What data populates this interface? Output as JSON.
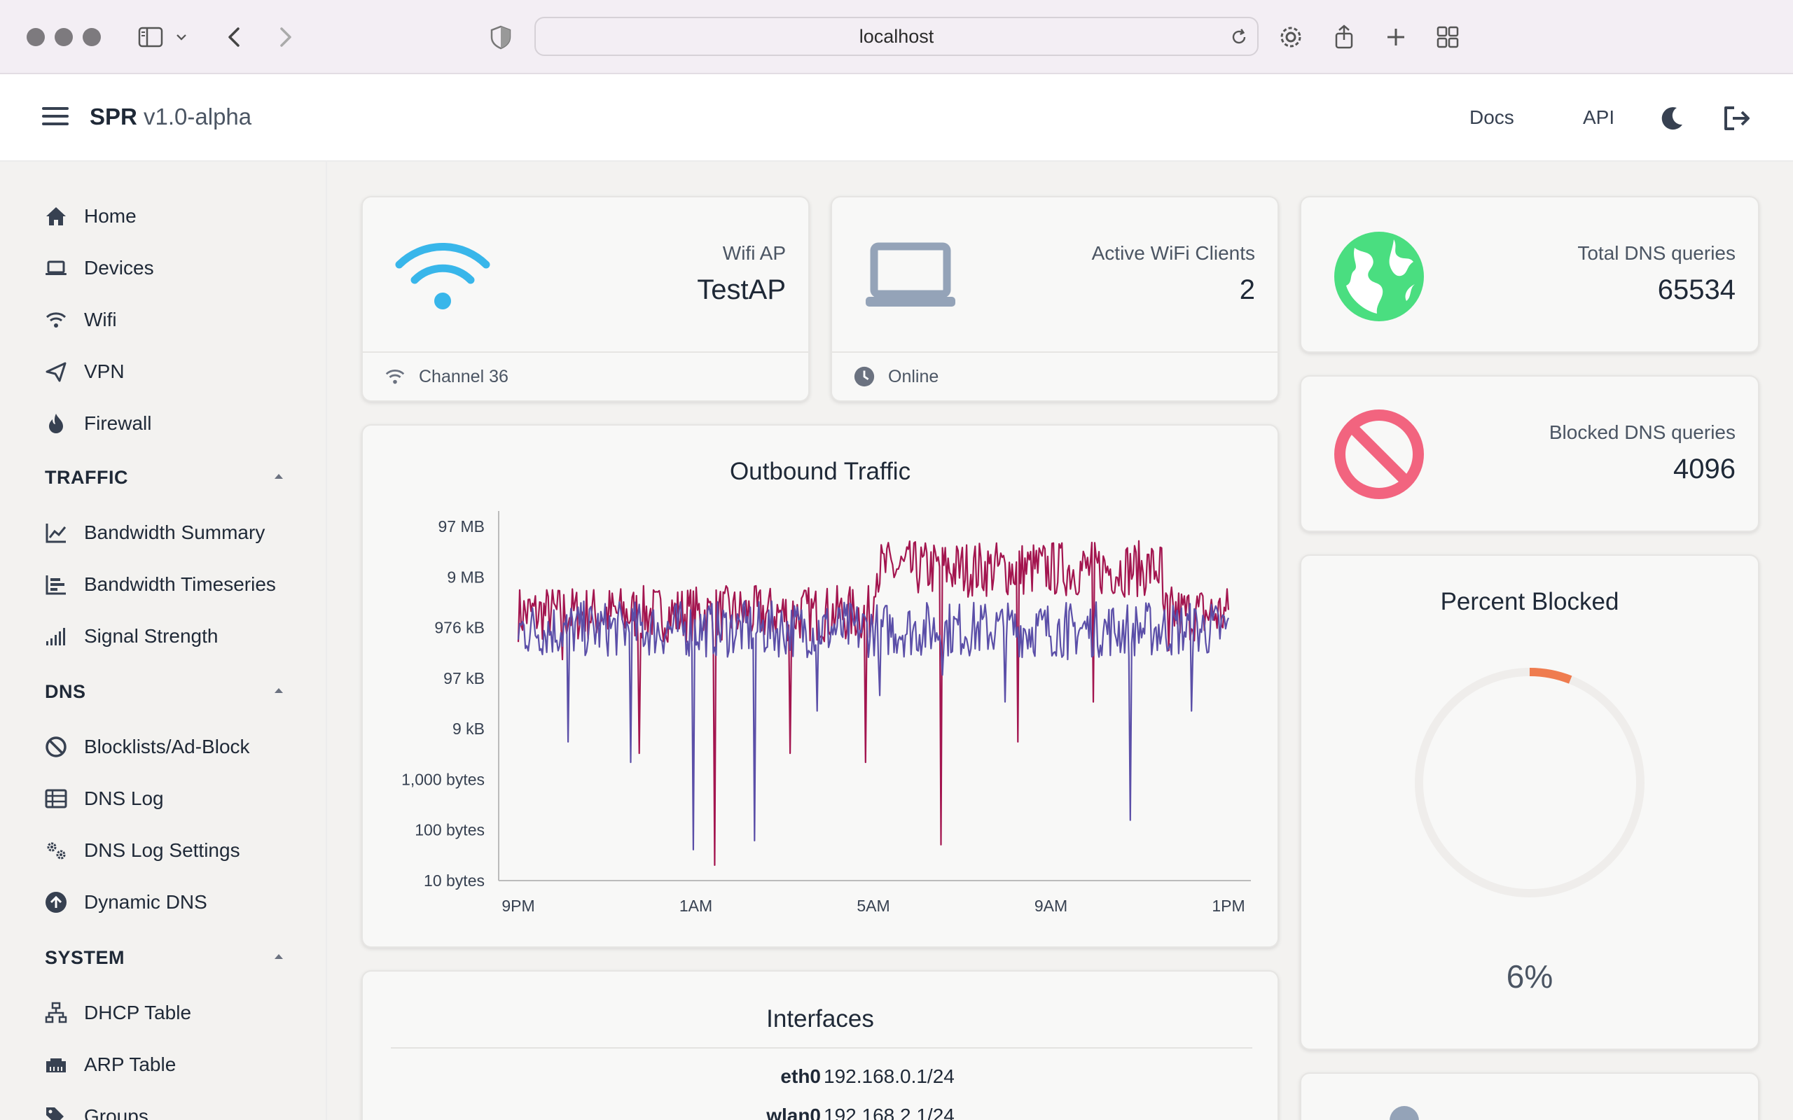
{
  "browser": {
    "url": "localhost"
  },
  "header": {
    "brand": "SPR",
    "version": "v1.0-alpha",
    "links": [
      "Docs",
      "API"
    ]
  },
  "sidebar": {
    "top_items": [
      {
        "label": "Home",
        "icon": "home-icon"
      },
      {
        "label": "Devices",
        "icon": "laptop-icon"
      },
      {
        "label": "Wifi",
        "icon": "wifi-icon"
      },
      {
        "label": "VPN",
        "icon": "send-icon"
      },
      {
        "label": "Firewall",
        "icon": "flame-icon"
      }
    ],
    "sections": [
      {
        "title": "TRAFFIC",
        "items": [
          {
            "label": "Bandwidth Summary",
            "icon": "line-chart-icon"
          },
          {
            "label": "Bandwidth Timeseries",
            "icon": "bar-chart-icon"
          },
          {
            "label": "Signal Strength",
            "icon": "signal-icon"
          }
        ]
      },
      {
        "title": "DNS",
        "items": [
          {
            "label": "Blocklists/Ad-Block",
            "icon": "ban-icon"
          },
          {
            "label": "DNS Log",
            "icon": "table-icon"
          },
          {
            "label": "DNS Log Settings",
            "icon": "cogs-icon"
          },
          {
            "label": "Dynamic DNS",
            "icon": "arrow-up-circle-icon"
          }
        ]
      },
      {
        "title": "SYSTEM",
        "items": [
          {
            "label": "DHCP Table",
            "icon": "network-icon"
          },
          {
            "label": "ARP Table",
            "icon": "ethernet-icon"
          },
          {
            "label": "Groups",
            "icon": "tags-icon"
          }
        ]
      }
    ]
  },
  "cards": {
    "wifi_ap": {
      "label": "Wifi AP",
      "value": "TestAP",
      "footer": "Channel 36"
    },
    "clients": {
      "label": "Active WiFi Clients",
      "value": "2",
      "footer": "Online"
    },
    "dns_total": {
      "label": "Total DNS queries",
      "value": "65534"
    },
    "dns_blocked": {
      "label": "Blocked DNS queries",
      "value": "4096"
    },
    "percent_blocked": {
      "title": "Percent Blocked",
      "value": "6%",
      "fraction": 0.06
    }
  },
  "colors": {
    "wifi": "#38b6ea",
    "laptop": "#94a3b8",
    "globe": "#4ade80",
    "blocked": "#f2647f",
    "donut": "#ef7c4f",
    "series_a": "#a3154f",
    "series_b": "#5b4fa8"
  },
  "chart_data": {
    "type": "line",
    "title": "Outbound Traffic",
    "y_scale": "log",
    "y_ticks": [
      "97 MB",
      "9 MB",
      "976 kB",
      "97 kB",
      "9 kB",
      "1,000 bytes",
      "100 bytes",
      "10 bytes"
    ],
    "x_ticks": [
      "9PM",
      "1AM",
      "5AM",
      "9AM",
      "1PM"
    ],
    "series": [
      {
        "color": "#a3154f",
        "typical": "2 MB",
        "raised": "15 MB",
        "raised_span": [
          "5AM",
          "11:30AM"
        ],
        "dips": [
          "0.2 MB",
          "3 kB",
          "20 bytes",
          "3 kB",
          "2 kB",
          "50 bytes",
          "5 kB",
          "30 kB",
          "0.3 MB"
        ]
      },
      {
        "color": "#5b4fa8",
        "typical": "1 MB",
        "dips": [
          "5 kB",
          "2 kB",
          "40 bytes",
          "60 bytes",
          "20 kB",
          "40 kB",
          "0.1 MB",
          "30 kB",
          "0.2 MB",
          "150 bytes",
          "20 kB"
        ]
      }
    ]
  },
  "interfaces": {
    "title": "Interfaces",
    "rows": [
      {
        "name": "eth0",
        "ip": "192.168.0.1/24"
      },
      {
        "name": "wlan0",
        "ip": "192.168.2.1/24"
      }
    ]
  }
}
